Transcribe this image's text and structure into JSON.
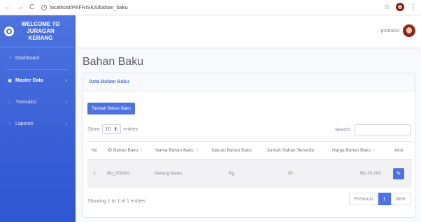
{
  "browser": {
    "url": "localhost/PAFRISKA/bahan_baku"
  },
  "sidebar": {
    "brand": "WELCOME TO JURAGAN KERANG",
    "items": [
      {
        "label": "Dashboard",
        "icon": "dashboard-icon"
      },
      {
        "label": "Master Data",
        "icon": "gear-icon"
      },
      {
        "label": "Transaksi",
        "icon": "transaction-icon"
      },
      {
        "label": "Laporan",
        "icon": "report-icon"
      }
    ]
  },
  "topbar": {
    "user": "produksi"
  },
  "page": {
    "title": "Bahan Baku",
    "card_title": "Data Bahan Baku",
    "add_button": "Tambah Bahan Baku",
    "show_label": "Show",
    "entries_value": "10",
    "entries_label": "entries",
    "search_label": "Search:",
    "info": "Showing 1 to 1 of 1 entries",
    "pager": {
      "previous": "Previous",
      "current": "1",
      "next": "Next"
    }
  },
  "table": {
    "headers": [
      "No",
      "ID Bahan Baku",
      "Nama Bahan Baku",
      "Satuan Bahan Baku",
      "Jumlah Bahan Tersedia",
      "Harga Bahan Baku",
      "Aksi"
    ],
    "rows": [
      [
        "1",
        "Bb_000001",
        "Kerang Madu",
        "Kg",
        "30",
        "Rp 20.000"
      ]
    ]
  },
  "colors": {
    "primary": "#4e73df",
    "sidebar": "#4e73df"
  }
}
